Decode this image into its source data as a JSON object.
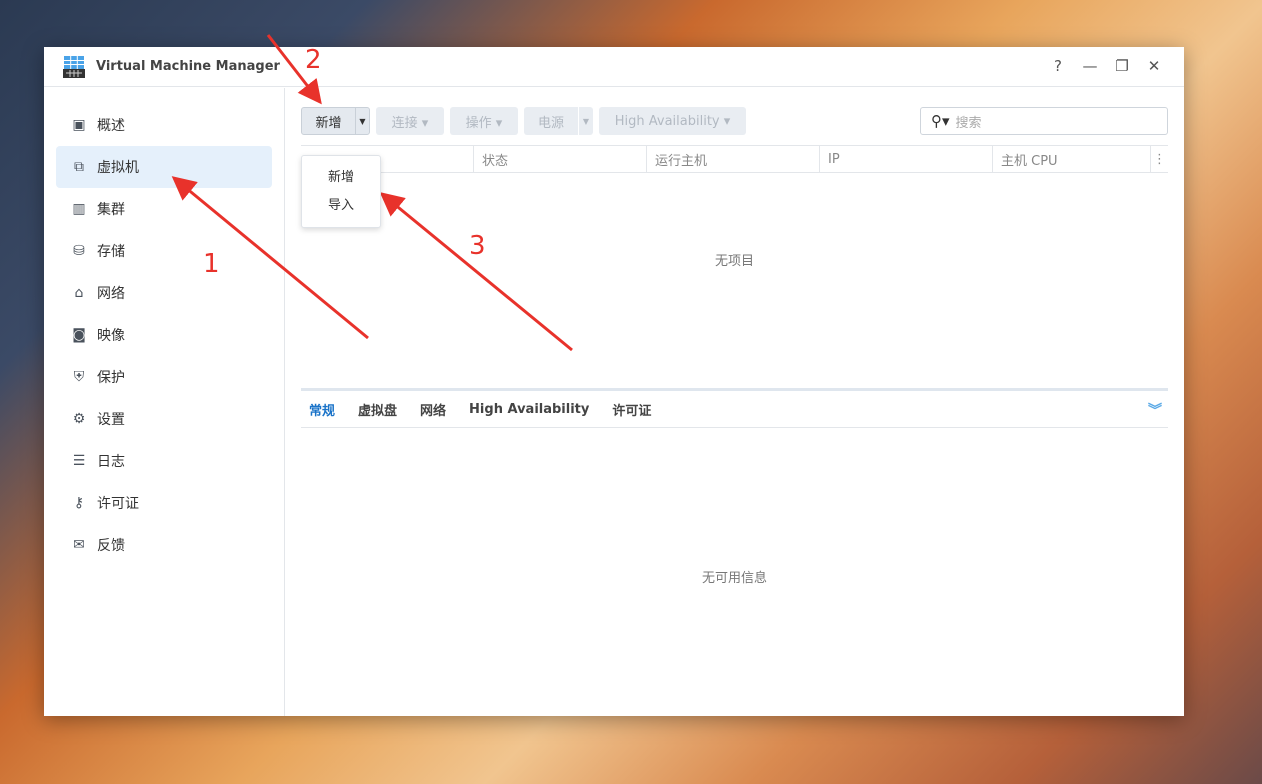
{
  "window": {
    "title": "Virtual Machine Manager",
    "controls": {
      "help": "?",
      "minimize": "—",
      "maximize": "❐",
      "close": "✕"
    }
  },
  "sidebar": {
    "items": [
      {
        "label": "概述",
        "icon": "overview-icon",
        "glyph": "▣"
      },
      {
        "label": "虚拟机",
        "icon": "virtual-machine-icon",
        "glyph": "⧉"
      },
      {
        "label": "集群",
        "icon": "cluster-icon",
        "glyph": "▥"
      },
      {
        "label": "存储",
        "icon": "storage-icon",
        "glyph": "⛁"
      },
      {
        "label": "网络",
        "icon": "network-icon",
        "glyph": "⌂"
      },
      {
        "label": "映像",
        "icon": "image-icon",
        "glyph": "◙"
      },
      {
        "label": "保护",
        "icon": "shield-icon",
        "glyph": "⛨"
      },
      {
        "label": "设置",
        "icon": "gear-icon",
        "glyph": "⚙"
      },
      {
        "label": "日志",
        "icon": "list-icon",
        "glyph": "☰"
      },
      {
        "label": "许可证",
        "icon": "key-icon",
        "glyph": "⚷"
      },
      {
        "label": "反馈",
        "icon": "mail-icon",
        "glyph": "✉"
      }
    ]
  },
  "toolbar": {
    "create": "新增",
    "connect": "连接 ▾",
    "action": "操作 ▾",
    "power": "电源",
    "ha": "High Availability ▾",
    "search_placeholder": "搜索"
  },
  "dropdown": {
    "items": [
      "新增",
      "导入"
    ]
  },
  "table": {
    "columns": [
      "状态",
      "运行主机",
      "IP",
      "主机 CPU"
    ],
    "empty": "无项目"
  },
  "detail": {
    "tabs": [
      "常规",
      "虚拟盘",
      "网络",
      "High Availability",
      "许可证"
    ],
    "empty": "无可用信息"
  },
  "annotations": [
    "1",
    "2",
    "3"
  ],
  "colors": {
    "accent": "#1a73c8",
    "annotation": "#e8322b"
  }
}
